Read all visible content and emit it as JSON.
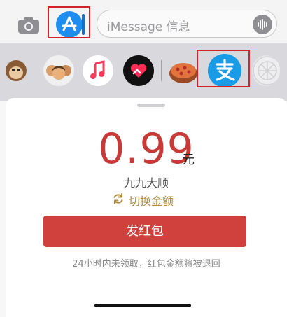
{
  "input": {
    "placeholder": "iMessage 信息"
  },
  "drawer": {
    "apps": [
      {
        "name": "monkey-memoji-icon"
      },
      {
        "name": "memoji-group-icon"
      },
      {
        "name": "music-icon"
      },
      {
        "name": "heart-digital-touch-icon"
      },
      {
        "name": "pizza-icon"
      },
      {
        "name": "alipay-icon"
      },
      {
        "name": "images-icon"
      }
    ]
  },
  "sheet": {
    "amount": "0.99",
    "unit": "元",
    "recipient": "九九大顺",
    "switch_label": "切换金额",
    "send_button": "发红包",
    "note": "24小时内未领取，红包金额将被退回"
  },
  "colors": {
    "accent_red": "#c83a37",
    "button_red": "#d0413d",
    "gold": "#b38b3b",
    "highlight_box": "#d0242a",
    "appstore_blue": "#1e8df0",
    "alipay_blue": "#1a9be6"
  }
}
